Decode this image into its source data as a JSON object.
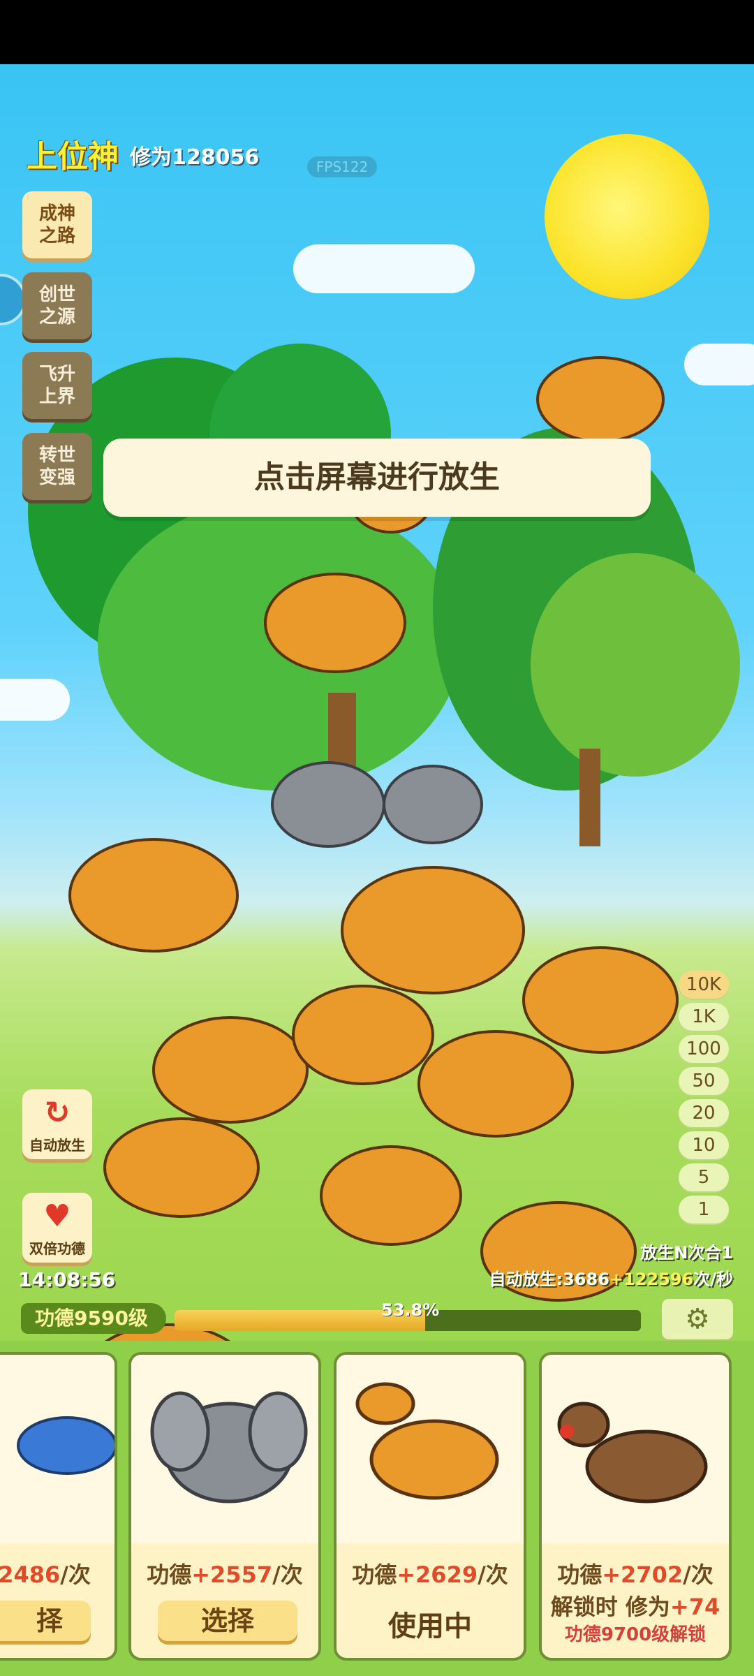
{
  "hud": {
    "rank": "上位神",
    "cultivation": "修为128056",
    "fps": "FPS122"
  },
  "side_menu": [
    {
      "label": "成神\n之路",
      "active": true
    },
    {
      "label": "创世\n之源",
      "active": false
    },
    {
      "label": "飞升\n上界",
      "active": false
    },
    {
      "label": "转世\n变强",
      "active": false
    }
  ],
  "banner": "点击屏幕进行放生",
  "multipliers": [
    "10K",
    "1K",
    "100",
    "50",
    "20",
    "10",
    "5",
    "1"
  ],
  "selected_multiplier": "10K",
  "auto_release_label": "自动放生",
  "double_merit_label": "双倍功德",
  "clock": "14:08:56",
  "release_mode": "放生N次合1",
  "auto_release_stats": {
    "prefix": "自动放生:3686",
    "bonus": "+122596",
    "suffix": "次/秒"
  },
  "merit_level": "功德9590级",
  "progress": {
    "label": "53.8%",
    "value": 53.8
  },
  "cards": [
    {
      "merit_prefix": "",
      "merit_value": "2486",
      "merit_suffix": "/次",
      "button": "择",
      "state": "select",
      "animal": "shark"
    },
    {
      "merit_prefix": "功德",
      "merit_value": "+2557",
      "merit_suffix": "/次",
      "button": "选择",
      "state": "select",
      "animal": "elephant"
    },
    {
      "merit_prefix": "功德",
      "merit_value": "+2629",
      "merit_suffix": "/次",
      "button": "使用中",
      "state": "in-use",
      "animal": "raptor"
    },
    {
      "merit_prefix": "功德",
      "merit_value": "+2702",
      "merit_suffix": "/次",
      "unlock_text": "解锁时 修为",
      "unlock_value": "+74",
      "unlock_requirement": "功德9700级解锁",
      "state": "locked",
      "animal": "reindeer"
    }
  ],
  "colors": {
    "sky": "#39c4f4",
    "grass": "#8ccf3e",
    "accent": "#e04b2a",
    "rank": "#f8f234"
  }
}
